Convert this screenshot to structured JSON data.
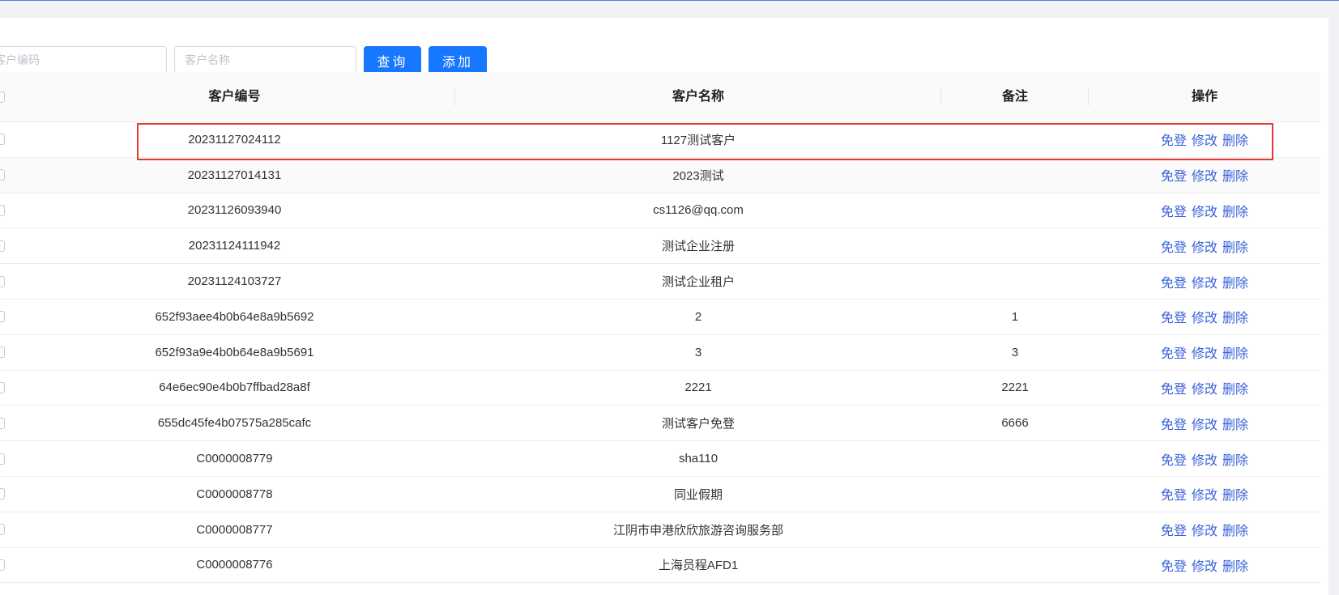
{
  "search": {
    "code_placeholder": "客户编码",
    "name_placeholder": "客户名称",
    "query_label": "查询",
    "add_label": "添加"
  },
  "table": {
    "headers": {
      "code": "客户编号",
      "name": "客户名称",
      "remark": "备注",
      "ops": "操作"
    },
    "actions": {
      "login": "免登",
      "edit": "修改",
      "delete": "删除"
    },
    "rows": [
      {
        "code": "20231127024112",
        "name": "1127测试客户",
        "remark": ""
      },
      {
        "code": "20231127014131",
        "name": "2023测试",
        "remark": ""
      },
      {
        "code": "20231126093940",
        "name": "cs1126@qq.com",
        "remark": ""
      },
      {
        "code": "20231124111942",
        "name": "测试企业注册",
        "remark": ""
      },
      {
        "code": "20231124103727",
        "name": "测试企业租户",
        "remark": ""
      },
      {
        "code": "652f93aee4b0b64e8a9b5692",
        "name": "2",
        "remark": "1"
      },
      {
        "code": "652f93a9e4b0b64e8a9b5691",
        "name": "3",
        "remark": "3"
      },
      {
        "code": "64e6ec90e4b0b7ffbad28a8f",
        "name": "2221",
        "remark": "2221"
      },
      {
        "code": "655dc45fe4b07575a285cafc",
        "name": "测试客户免登",
        "remark": "6666"
      },
      {
        "code": "C0000008779",
        "name": "sha110",
        "remark": ""
      },
      {
        "code": "C0000008778",
        "name": "同业假期",
        "remark": ""
      },
      {
        "code": "C0000008777",
        "name": "江阴市申港欣欣旅游咨询服务部",
        "remark": ""
      },
      {
        "code": "C0000008776",
        "name": "上海员程AFD1",
        "remark": ""
      }
    ]
  }
}
